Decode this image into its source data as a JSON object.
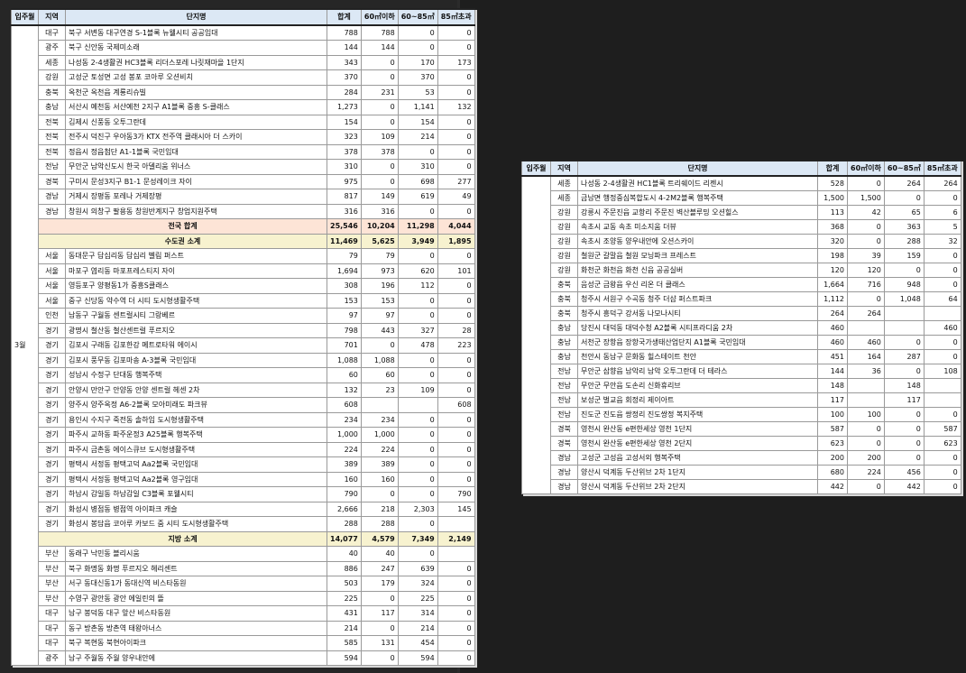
{
  "headers": [
    "입주월",
    "지역",
    "단지명",
    "합계",
    "60㎡이하",
    "60~85㎡",
    "85㎡초과"
  ],
  "left_table": {
    "month": "3월",
    "rows": [
      {
        "region": "대구",
        "name": "북구 서변동 대구연경 S-1블록 뉴웰시티 공공임대",
        "total": "788",
        "a": "788",
        "b": "0",
        "c": "0"
      },
      {
        "region": "광주",
        "name": "북구 신안동 국제미소래",
        "total": "144",
        "a": "144",
        "b": "0",
        "c": "0"
      },
      {
        "region": "세종",
        "name": "나성동 2-4생활권 HC3블록 리더스포레 나릿재마을 1단지",
        "total": "343",
        "a": "0",
        "b": "170",
        "c": "173"
      },
      {
        "region": "강원",
        "name": "고성군 토성면 고성 봉포 코아루 오션비치",
        "total": "370",
        "a": "0",
        "b": "370",
        "c": "0"
      },
      {
        "region": "충북",
        "name": "옥천군 옥천읍 계룡리슈빌",
        "total": "284",
        "a": "231",
        "b": "53",
        "c": "0"
      },
      {
        "region": "충남",
        "name": "서산시 예천동 서산예천 2지구 A1블록 중흥 S-클래스",
        "total": "1,273",
        "a": "0",
        "b": "1,141",
        "c": "132"
      },
      {
        "region": "전북",
        "name": "김제시 신풍동 오투그란데",
        "total": "154",
        "a": "0",
        "b": "154",
        "c": "0"
      },
      {
        "region": "전북",
        "name": "전주시 덕진구 우아동3가 KTX 전주역 클래시아 더 스카이",
        "total": "323",
        "a": "109",
        "b": "214",
        "c": "0"
      },
      {
        "region": "전북",
        "name": "정읍시 정읍첨단 A1-1블록 국민임대",
        "total": "378",
        "a": "378",
        "b": "0",
        "c": "0"
      },
      {
        "region": "전남",
        "name": "무안군 남악신도시 한국 아델리움 위너스",
        "total": "310",
        "a": "0",
        "b": "310",
        "c": "0"
      },
      {
        "region": "경북",
        "name": "구미시 문성3지구 B1-1 문성레이크 자이",
        "total": "975",
        "a": "0",
        "b": "698",
        "c": "277"
      },
      {
        "region": "경남",
        "name": "거제시 장평동 포레나 거제장평",
        "total": "817",
        "a": "149",
        "b": "619",
        "c": "49"
      },
      {
        "region": "경남",
        "name": "창원시 의창구 팔용동 창원반계지구 창업지원주택",
        "total": "316",
        "a": "316",
        "b": "0",
        "c": "0"
      },
      {
        "type": "total",
        "name": "전국 합계",
        "total": "25,546",
        "a": "10,204",
        "b": "11,298",
        "c": "4,044"
      },
      {
        "type": "sub",
        "name": "수도권 소계",
        "total": "11,469",
        "a": "5,625",
        "b": "3,949",
        "c": "1,895"
      },
      {
        "region": "서울",
        "name": "동대문구 답십리동 답십리 벨림 퍼스트",
        "total": "79",
        "a": "79",
        "b": "0",
        "c": "0"
      },
      {
        "region": "서울",
        "name": "마포구 염리동 마포프레스티지 자이",
        "total": "1,694",
        "a": "973",
        "b": "620",
        "c": "101"
      },
      {
        "region": "서울",
        "name": "영등포구 양평동1가 중흥S클래스",
        "total": "308",
        "a": "196",
        "b": "112",
        "c": "0"
      },
      {
        "region": "서울",
        "name": "중구 신당동 약수역 더 시티 도시형생활주택",
        "total": "153",
        "a": "153",
        "b": "0",
        "c": "0"
      },
      {
        "region": "인천",
        "name": "남동구 구월동 센트럴시티 그랑베르",
        "total": "97",
        "a": "97",
        "b": "0",
        "c": "0"
      },
      {
        "region": "경기",
        "name": "광명시 철산동 철산센트럴 푸르지오",
        "total": "798",
        "a": "443",
        "b": "327",
        "c": "28"
      },
      {
        "region": "경기",
        "name": "김포시 구래동 김포한강 메트로타워 에이시",
        "total": "701",
        "a": "0",
        "b": "478",
        "c": "223"
      },
      {
        "region": "경기",
        "name": "김포시 풍무동 김포마송 A-3블록 국민임대",
        "total": "1,088",
        "a": "1,088",
        "b": "0",
        "c": "0"
      },
      {
        "region": "경기",
        "name": "성남시 수정구 단대동 행복주택",
        "total": "60",
        "a": "60",
        "b": "0",
        "c": "0"
      },
      {
        "region": "경기",
        "name": "안양시 만안구 안양동 안양 센트럴 헤센 2차",
        "total": "132",
        "a": "23",
        "b": "109",
        "c": "0"
      },
      {
        "region": "경기",
        "name": "양주시 양주옥정 A6-2블록 모아미래도 파크뷰",
        "total": "608",
        "a": "",
        "b": "",
        "c": "608"
      },
      {
        "region": "경기",
        "name": "용인시 수지구 죽전동 솔하임 도시형생활주택",
        "total": "234",
        "a": "234",
        "b": "0",
        "c": "0"
      },
      {
        "region": "경기",
        "name": "파주시 교하동 파주운정3 A25블록 행복주택",
        "total": "1,000",
        "a": "1,000",
        "b": "0",
        "c": "0"
      },
      {
        "region": "경기",
        "name": "파주시 금촌동 에이스큐브 도시형생활주택",
        "total": "224",
        "a": "224",
        "b": "0",
        "c": "0"
      },
      {
        "region": "경기",
        "name": "평택시 서정동 평택고덕 Aa2블록 국민임대",
        "total": "389",
        "a": "389",
        "b": "0",
        "c": "0"
      },
      {
        "region": "경기",
        "name": "평택시 서정동 평택고덕 Aa2블록 영구임대",
        "total": "160",
        "a": "160",
        "b": "0",
        "c": "0"
      },
      {
        "region": "경기",
        "name": "하남시 감일동 하남감일 C3블록 포웰시티",
        "total": "790",
        "a": "0",
        "b": "0",
        "c": "790"
      },
      {
        "region": "경기",
        "name": "화성시 병점동 병점역 아이파크 캐슬",
        "total": "2,666",
        "a": "218",
        "b": "2,303",
        "c": "145"
      },
      {
        "region": "경기",
        "name": "화성시 봉담읍 코아루 카보드 줌 시티 도시형생활주택",
        "total": "288",
        "a": "288",
        "b": "0",
        "c": ""
      },
      {
        "type": "sub",
        "name": "지방 소계",
        "total": "14,077",
        "a": "4,579",
        "b": "7,349",
        "c": "2,149"
      },
      {
        "region": "부산",
        "name": "동래구 낙민동 블리시움",
        "total": "40",
        "a": "40",
        "b": "0",
        "c": ""
      },
      {
        "region": "부산",
        "name": "북구 화명동 화명 푸르지오 헤리센트",
        "total": "886",
        "a": "247",
        "b": "639",
        "c": "0"
      },
      {
        "region": "부산",
        "name": "서구 동대신동1가 동대신역 비스타동원",
        "total": "503",
        "a": "179",
        "b": "324",
        "c": "0"
      },
      {
        "region": "부산",
        "name": "수영구 광안동 광안 에일린의 뜰",
        "total": "225",
        "a": "0",
        "b": "225",
        "c": "0"
      },
      {
        "region": "대구",
        "name": "남구 봉덕동 대구 앞산 비스타동원",
        "total": "431",
        "a": "117",
        "b": "314",
        "c": "0"
      },
      {
        "region": "대구",
        "name": "동구 방촌동 방촌역 태왕아너스",
        "total": "214",
        "a": "0",
        "b": "214",
        "c": "0"
      },
      {
        "region": "대구",
        "name": "북구 복현동 북현아이파크",
        "total": "585",
        "a": "131",
        "b": "454",
        "c": "0"
      },
      {
        "region": "광주",
        "name": "남구 주월동 주월 양우내안에",
        "total": "594",
        "a": "0",
        "b": "594",
        "c": "0"
      }
    ]
  },
  "right_table": {
    "rows": [
      {
        "region": "세종",
        "name": "나성동 2-4생활권 HC1블록 트리쉐이드 리젠시",
        "total": "528",
        "a": "0",
        "b": "264",
        "c": "264"
      },
      {
        "region": "세종",
        "name": "금남면 행정중심복합도시 4-2M2블록 행복주택",
        "total": "1,500",
        "a": "1,500",
        "b": "0",
        "c": "0"
      },
      {
        "region": "강원",
        "name": "강릉시 주문진읍 교항리 주문진 벽산블루밍 오션힐스",
        "total": "113",
        "a": "42",
        "b": "65",
        "c": "6"
      },
      {
        "region": "강원",
        "name": "속초시 교동 속초 미소지움 더뷰",
        "total": "368",
        "a": "0",
        "b": "363",
        "c": "5"
      },
      {
        "region": "강원",
        "name": "속초시 조양동 양우내안에 오션스카이",
        "total": "320",
        "a": "0",
        "b": "288",
        "c": "32"
      },
      {
        "region": "강원",
        "name": "철원군 갈말읍 철원 모닝파크 프레스트",
        "total": "198",
        "a": "39",
        "b": "159",
        "c": "0"
      },
      {
        "region": "강원",
        "name": "화천군 화천읍 화천 신읍 공공실버",
        "total": "120",
        "a": "120",
        "b": "0",
        "c": "0"
      },
      {
        "region": "충북",
        "name": "음성군 금왕읍 우신 리온 더 클래스",
        "total": "1,664",
        "a": "716",
        "b": "948",
        "c": "0"
      },
      {
        "region": "충북",
        "name": "청주시 서원구 수곡동 청주 더샵 퍼스트파크",
        "total": "1,112",
        "a": "0",
        "b": "1,048",
        "c": "64"
      },
      {
        "region": "충북",
        "name": "청주시 흥덕구 강서동 나모나시티",
        "total": "264",
        "a": "264",
        "b": "",
        "c": ""
      },
      {
        "region": "충남",
        "name": "당진시 대덕동 대덕수청 A2블록 시티프라디움 2차",
        "total": "460",
        "a": "",
        "b": "",
        "c": "460"
      },
      {
        "region": "충남",
        "name": "서천군 장항읍 장항국가생태산업단지 A1블록 국민임대",
        "total": "460",
        "a": "460",
        "b": "0",
        "c": "0"
      },
      {
        "region": "충남",
        "name": "천안시 동남구 문화동 힐스테이트 천안",
        "total": "451",
        "a": "164",
        "b": "287",
        "c": "0"
      },
      {
        "region": "전남",
        "name": "무안군 삼향읍 남악리 남악 오투그란데 더 테라스",
        "total": "144",
        "a": "36",
        "b": "0",
        "c": "108"
      },
      {
        "region": "전남",
        "name": "무안군 무안읍 도손리 신화휴리브",
        "total": "148",
        "a": "",
        "b": "148",
        "c": ""
      },
      {
        "region": "전남",
        "name": "보성군 벌교읍 회정리 제이아트",
        "total": "117",
        "a": "",
        "b": "117",
        "c": ""
      },
      {
        "region": "전남",
        "name": "진도군 진도읍 쌍정리 진도쌍정 복지주택",
        "total": "100",
        "a": "100",
        "b": "0",
        "c": "0"
      },
      {
        "region": "경북",
        "name": "영천시 완산동 e편한세상 영천 1단지",
        "total": "587",
        "a": "0",
        "b": "0",
        "c": "587"
      },
      {
        "region": "경북",
        "name": "영천시 완산동 e편한세상 영천 2단지",
        "total": "623",
        "a": "0",
        "b": "0",
        "c": "623"
      },
      {
        "region": "경남",
        "name": "고성군 고성읍 고성서외 행복주택",
        "total": "200",
        "a": "200",
        "b": "0",
        "c": "0"
      },
      {
        "region": "경남",
        "name": "양산시 덕계동 두산위브 2차 1단지",
        "total": "680",
        "a": "224",
        "b": "456",
        "c": "0"
      },
      {
        "region": "경남",
        "name": "양산시 덕계동 두산위브 2차 2단지",
        "total": "442",
        "a": "0",
        "b": "442",
        "c": "0"
      }
    ]
  }
}
